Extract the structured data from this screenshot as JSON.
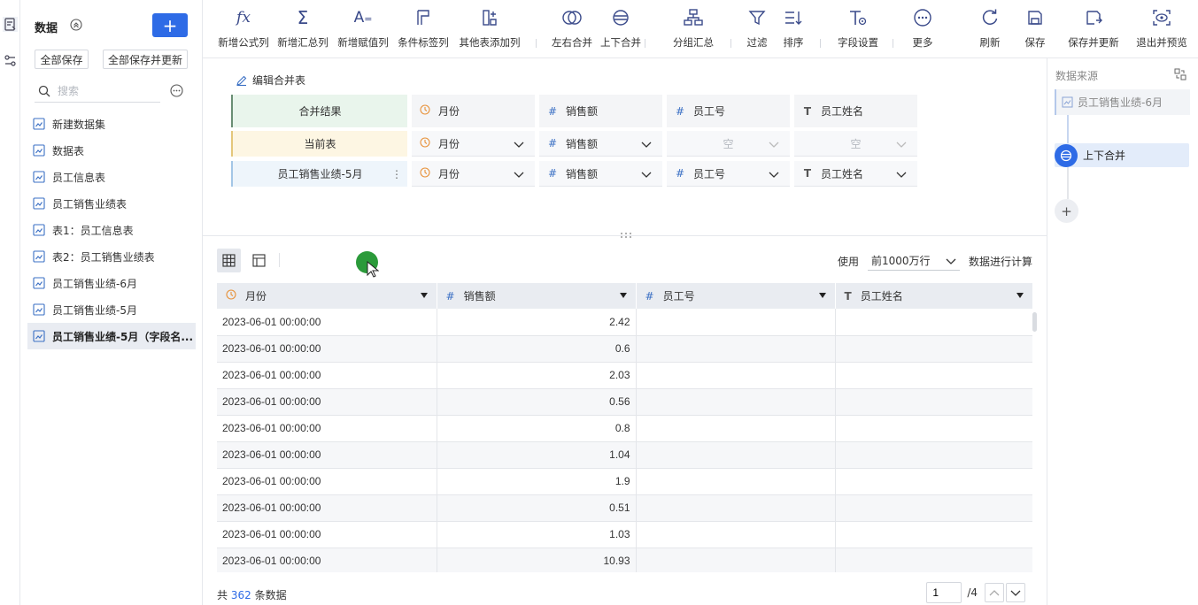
{
  "colors": {
    "accent": "#2e6be6",
    "merged_row": "#e9f5ec",
    "current_row": "#fdf6e3",
    "table_row": "#eef5fb",
    "cursor": "#2b9a3a"
  },
  "panel": {
    "title": "数据",
    "add_label": "+",
    "save_all": "全部保存",
    "save_all_update": "全部保存并更新",
    "search_placeholder": "搜索",
    "items": [
      {
        "label": "新建数据集"
      },
      {
        "label": "数据表"
      },
      {
        "label": "员工信息表"
      },
      {
        "label": "员工销售业绩表"
      },
      {
        "label": "表1：员工信息表"
      },
      {
        "label": "表2：员工销售业绩表"
      },
      {
        "label": "员工销售业绩-6月"
      },
      {
        "label": "员工销售业绩-5月"
      },
      {
        "label": "员工销售业绩-5月（字段名..."
      }
    ]
  },
  "toolbar": {
    "items": [
      {
        "label": "新增公式列",
        "icon": "fx-icon"
      },
      {
        "label": "新增汇总列",
        "icon": "sigma-icon"
      },
      {
        "label": "新增赋值列",
        "icon": "assign-icon"
      },
      {
        "label": "条件标签列",
        "icon": "flag-icon"
      },
      {
        "label": "其他表添加列",
        "icon": "add-column-icon"
      },
      {
        "label": "左右合并",
        "icon": "venn-icon"
      },
      {
        "label": "上下合并",
        "icon": "union-icon"
      },
      {
        "label": "分组汇总",
        "icon": "group-icon"
      },
      {
        "label": "过滤",
        "icon": "filter-icon"
      },
      {
        "label": "排序",
        "icon": "sort-icon"
      },
      {
        "label": "字段设置",
        "icon": "field-settings-icon"
      },
      {
        "label": "更多",
        "icon": "more-icon"
      },
      {
        "label": "刷新",
        "icon": "refresh-icon"
      },
      {
        "label": "保存",
        "icon": "save-icon"
      },
      {
        "label": "保存并更新",
        "icon": "save-update-icon"
      },
      {
        "label": "退出并预览",
        "icon": "exit-preview-icon"
      }
    ]
  },
  "editor": {
    "edit_link": "编辑合并表",
    "rows": [
      {
        "label": "合并结果",
        "cells": [
          {
            "type": "clock",
            "text": "月份"
          },
          {
            "type": "hash",
            "text": "销售额"
          },
          {
            "type": "hash",
            "text": "员工号"
          },
          {
            "type": "text",
            "text": "员工姓名"
          }
        ]
      },
      {
        "label": "当前表",
        "cells": [
          {
            "type": "clock",
            "text": "月份"
          },
          {
            "type": "hash",
            "text": "销售额"
          },
          {
            "type": "empty",
            "text": "空"
          },
          {
            "type": "empty",
            "text": "空"
          }
        ]
      },
      {
        "label": "员工销售业绩-5月",
        "cells": [
          {
            "type": "clock",
            "text": "月份"
          },
          {
            "type": "hash",
            "text": "销售额"
          },
          {
            "type": "hash",
            "text": "员工号"
          },
          {
            "type": "text",
            "text": "员工姓名"
          }
        ]
      }
    ]
  },
  "preview": {
    "use_label": "使用",
    "row_limit": "前1000万行",
    "use_suffix": "数据进行计算",
    "columns": [
      {
        "label": "月份",
        "type": "clock"
      },
      {
        "label": "销售额",
        "type": "hash"
      },
      {
        "label": "员工号",
        "type": "hash"
      },
      {
        "label": "员工姓名",
        "type": "text"
      }
    ],
    "rows": [
      [
        "2023-06-01 00:00:00",
        "2.42",
        "",
        ""
      ],
      [
        "2023-06-01 00:00:00",
        "0.6",
        "",
        ""
      ],
      [
        "2023-06-01 00:00:00",
        "2.03",
        "",
        ""
      ],
      [
        "2023-06-01 00:00:00",
        "0.56",
        "",
        ""
      ],
      [
        "2023-06-01 00:00:00",
        "0.8",
        "",
        ""
      ],
      [
        "2023-06-01 00:00:00",
        "1.04",
        "",
        ""
      ],
      [
        "2023-06-01 00:00:00",
        "1.9",
        "",
        ""
      ],
      [
        "2023-06-01 00:00:00",
        "0.51",
        "",
        ""
      ],
      [
        "2023-06-01 00:00:00",
        "1.03",
        "",
        ""
      ],
      [
        "2023-06-01 00:00:00",
        "10.93",
        "",
        ""
      ]
    ],
    "count_prefix": "共",
    "count": "362",
    "count_suffix": "条数据",
    "page": "1",
    "page_total": "/4"
  },
  "source": {
    "title": "数据来源",
    "table_node": "员工销售业绩-6月",
    "merge_node": "上下合并",
    "add_node": "+"
  }
}
